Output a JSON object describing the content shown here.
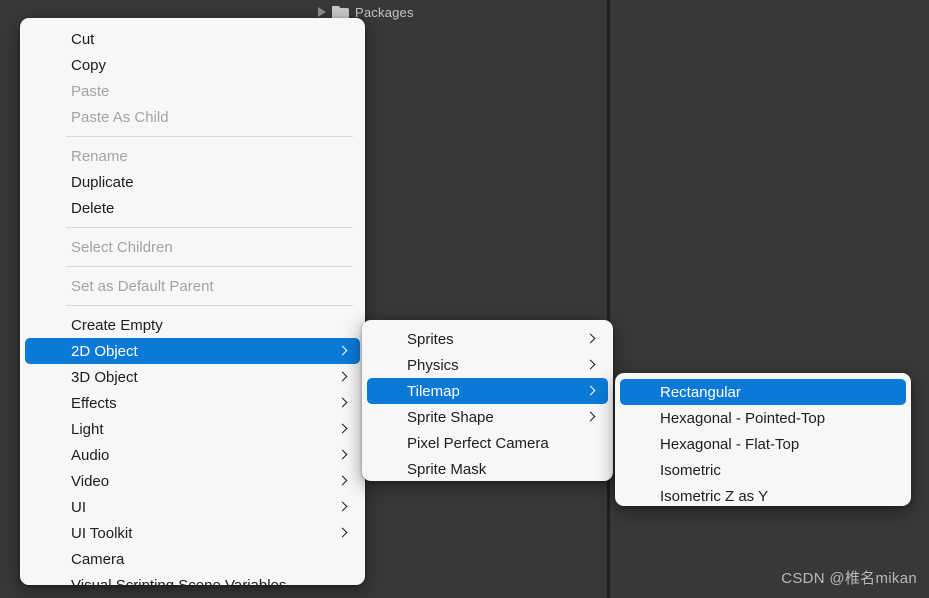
{
  "background": {
    "hierarchy_row": {
      "label": "Packages",
      "expand_icon": "triangle-right-icon",
      "folder_icon": "folder-icon"
    },
    "watermark": "CSDN @椎名mikan",
    "colors": {
      "editor_bg": "#383838",
      "divider": "#1f1f1f",
      "menu_bg": "#f7f7f7",
      "highlight": "#0b7ad6",
      "text": "#1d1d1d",
      "text_disabled": "#a3a3a3"
    }
  },
  "context_menu": {
    "items": [
      {
        "label": "Cut",
        "type": "item",
        "enabled": true,
        "submenu": false,
        "highlighted": false
      },
      {
        "label": "Copy",
        "type": "item",
        "enabled": true,
        "submenu": false,
        "highlighted": false
      },
      {
        "label": "Paste",
        "type": "item",
        "enabled": false,
        "submenu": false,
        "highlighted": false
      },
      {
        "label": "Paste As Child",
        "type": "item",
        "enabled": false,
        "submenu": false,
        "highlighted": false
      },
      {
        "label": "",
        "type": "separator",
        "enabled": true,
        "submenu": false,
        "highlighted": false
      },
      {
        "label": "Rename",
        "type": "item",
        "enabled": false,
        "submenu": false,
        "highlighted": false
      },
      {
        "label": "Duplicate",
        "type": "item",
        "enabled": true,
        "submenu": false,
        "highlighted": false
      },
      {
        "label": "Delete",
        "type": "item",
        "enabled": true,
        "submenu": false,
        "highlighted": false
      },
      {
        "label": "",
        "type": "separator",
        "enabled": true,
        "submenu": false,
        "highlighted": false
      },
      {
        "label": "Select Children",
        "type": "item",
        "enabled": false,
        "submenu": false,
        "highlighted": false
      },
      {
        "label": "",
        "type": "separator",
        "enabled": true,
        "submenu": false,
        "highlighted": false
      },
      {
        "label": "Set as Default Parent",
        "type": "item",
        "enabled": false,
        "submenu": false,
        "highlighted": false
      },
      {
        "label": "",
        "type": "separator",
        "enabled": true,
        "submenu": false,
        "highlighted": false
      },
      {
        "label": "Create Empty",
        "type": "item",
        "enabled": true,
        "submenu": false,
        "highlighted": false
      },
      {
        "label": "2D Object",
        "type": "item",
        "enabled": true,
        "submenu": true,
        "highlighted": true
      },
      {
        "label": "3D Object",
        "type": "item",
        "enabled": true,
        "submenu": true,
        "highlighted": false
      },
      {
        "label": "Effects",
        "type": "item",
        "enabled": true,
        "submenu": true,
        "highlighted": false
      },
      {
        "label": "Light",
        "type": "item",
        "enabled": true,
        "submenu": true,
        "highlighted": false
      },
      {
        "label": "Audio",
        "type": "item",
        "enabled": true,
        "submenu": true,
        "highlighted": false
      },
      {
        "label": "Video",
        "type": "item",
        "enabled": true,
        "submenu": true,
        "highlighted": false
      },
      {
        "label": "UI",
        "type": "item",
        "enabled": true,
        "submenu": true,
        "highlighted": false
      },
      {
        "label": "UI Toolkit",
        "type": "item",
        "enabled": true,
        "submenu": true,
        "highlighted": false
      },
      {
        "label": "Camera",
        "type": "item",
        "enabled": true,
        "submenu": false,
        "highlighted": false
      },
      {
        "label": "Visual Scripting Scene Variables",
        "type": "item",
        "enabled": true,
        "submenu": false,
        "highlighted": false
      }
    ]
  },
  "submenu_2d_object": {
    "parent": "2D Object",
    "items": [
      {
        "label": "Sprites",
        "type": "item",
        "enabled": true,
        "submenu": true,
        "highlighted": false
      },
      {
        "label": "Physics",
        "type": "item",
        "enabled": true,
        "submenu": true,
        "highlighted": false
      },
      {
        "label": "Tilemap",
        "type": "item",
        "enabled": true,
        "submenu": true,
        "highlighted": true
      },
      {
        "label": "Sprite Shape",
        "type": "item",
        "enabled": true,
        "submenu": true,
        "highlighted": false
      },
      {
        "label": "Pixel Perfect Camera",
        "type": "item",
        "enabled": true,
        "submenu": false,
        "highlighted": false
      },
      {
        "label": "Sprite Mask",
        "type": "item",
        "enabled": true,
        "submenu": false,
        "highlighted": false
      }
    ]
  },
  "submenu_tilemap": {
    "parent": "Tilemap",
    "items": [
      {
        "label": "Rectangular",
        "type": "item",
        "enabled": true,
        "submenu": false,
        "highlighted": true
      },
      {
        "label": "Hexagonal - Pointed-Top",
        "type": "item",
        "enabled": true,
        "submenu": false,
        "highlighted": false
      },
      {
        "label": "Hexagonal - Flat-Top",
        "type": "item",
        "enabled": true,
        "submenu": false,
        "highlighted": false
      },
      {
        "label": "Isometric",
        "type": "item",
        "enabled": true,
        "submenu": false,
        "highlighted": false
      },
      {
        "label": "Isometric Z as Y",
        "type": "item",
        "enabled": true,
        "submenu": false,
        "highlighted": false
      }
    ]
  }
}
